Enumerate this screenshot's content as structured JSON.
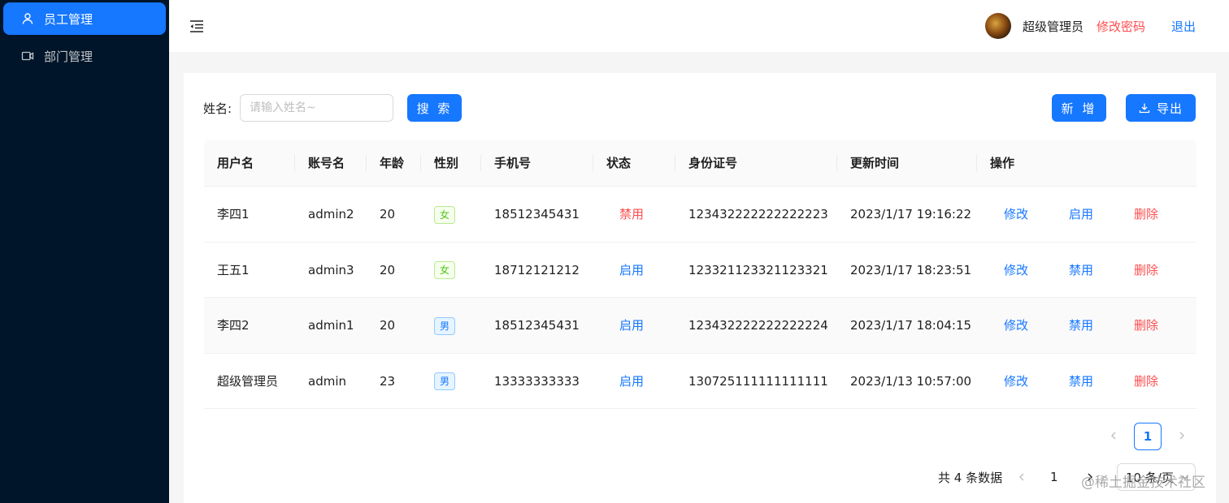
{
  "sidebar": {
    "items": [
      {
        "label": "员工管理",
        "icon": "user-icon",
        "active": true
      },
      {
        "label": "部门管理",
        "icon": "video-icon",
        "active": false
      }
    ]
  },
  "header": {
    "username": "超级管理员",
    "change_password": "修改密码",
    "logout": "退出"
  },
  "search": {
    "label": "姓名:",
    "placeholder": "请输入姓名~",
    "value": "",
    "button": "搜 索"
  },
  "toolbar": {
    "add": "新 增",
    "export": "导出"
  },
  "table": {
    "columns": [
      "用户名",
      "账号名",
      "年龄",
      "性别",
      "手机号",
      "状态",
      "身份证号",
      "更新时间",
      "操作"
    ],
    "rows": [
      {
        "name": "李四1",
        "account": "admin2",
        "age": "20",
        "gender": "女",
        "phone": "18512345431",
        "status": "禁用",
        "id_number": "123432222222222223",
        "updated": "2023/1/17 19:16:22",
        "edit": "修改",
        "toggle": "启用",
        "delete": "删除"
      },
      {
        "name": "王五1",
        "account": "admin3",
        "age": "20",
        "gender": "女",
        "phone": "18712121212",
        "status": "启用",
        "id_number": "123321123321123321",
        "updated": "2023/1/17 18:23:51",
        "edit": "修改",
        "toggle": "禁用",
        "delete": "删除"
      },
      {
        "name": "李四2",
        "account": "admin1",
        "age": "20",
        "gender": "男",
        "phone": "18512345431",
        "status": "启用",
        "id_number": "123432222222222224",
        "updated": "2023/1/17 18:04:15",
        "edit": "修改",
        "toggle": "禁用",
        "delete": "删除"
      },
      {
        "name": "超级管理员",
        "account": "admin",
        "age": "23",
        "gender": "男",
        "phone": "13333333333",
        "status": "启用",
        "id_number": "130725111111111111",
        "updated": "2023/1/13 10:57:00",
        "edit": "修改",
        "toggle": "禁用",
        "delete": "删除"
      }
    ]
  },
  "pagination_top": {
    "current": "1"
  },
  "pagination": {
    "total": "共 4 条数据",
    "current": "1",
    "page_size": "10 条/页"
  },
  "watermark": "@稀土掘金技术社区",
  "colors": {
    "primary": "#1677ff",
    "danger": "#ff4d4f",
    "sidebar": "#001529"
  }
}
